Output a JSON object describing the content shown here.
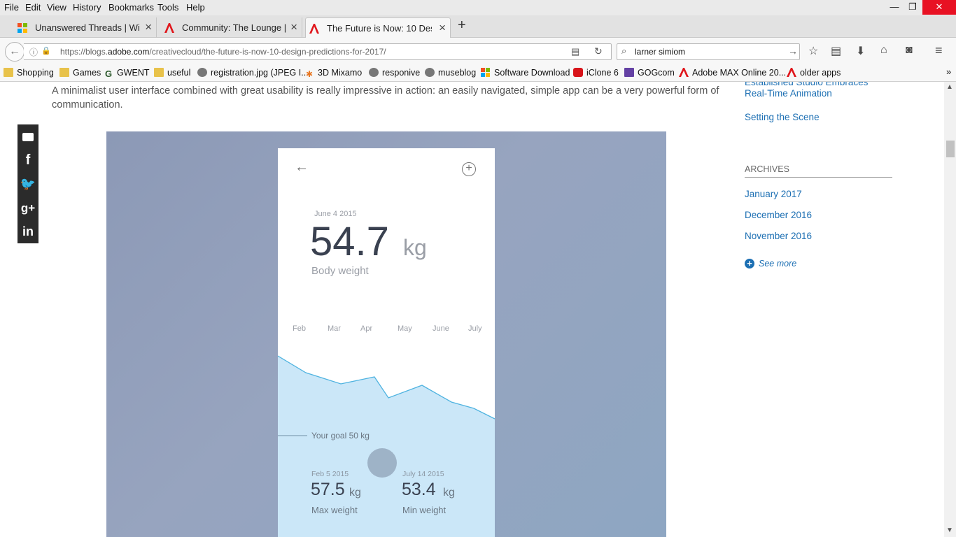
{
  "menubar": {
    "items": [
      "File",
      "Edit",
      "View",
      "History",
      "Bookmarks",
      "Tools",
      "Help"
    ],
    "window_controls": [
      "—",
      "❐",
      "✕"
    ]
  },
  "tabs": [
    {
      "title": "Unanswered Threads | Wi...",
      "active": false
    },
    {
      "title": "Community: The Lounge |...",
      "active": false
    },
    {
      "title": "The Future is Now: 10 Desi...",
      "active": true
    }
  ],
  "new_tab_label": "+",
  "navbar": {
    "url_prefix": "https://blogs.",
    "url_domain": "adobe.com",
    "url_path": "/creativecloud/the-future-is-now-10-design-predictions-for-2017/",
    "search_value": "larner simiom"
  },
  "bookmarks": [
    {
      "label": "Shopping",
      "icon": "folder-icon"
    },
    {
      "label": "Games",
      "icon": "folder-icon"
    },
    {
      "label": "GWENT",
      "icon": "gwent-icon"
    },
    {
      "label": "useful",
      "icon": "folder-icon"
    },
    {
      "label": "registration.jpg (JPEG I...",
      "icon": "globe-icon"
    },
    {
      "label": "3D Mixamo",
      "icon": "mixamo-icon"
    },
    {
      "label": "responive",
      "icon": "globe-icon"
    },
    {
      "label": "museblog",
      "icon": "globe-icon"
    },
    {
      "label": "Software Download",
      "icon": "windows-icon"
    },
    {
      "label": "iClone 6",
      "icon": "youtube-icon"
    },
    {
      "label": "GOGcom",
      "icon": "twitch-icon"
    },
    {
      "label": "Adobe MAX Online 20...",
      "icon": "adobe-icon"
    },
    {
      "label": "older apps",
      "icon": "adobe-icon"
    }
  ],
  "article": {
    "paragraph": "A minimalist user interface combined with great usability is really impressive in action: an easily navigated, simple app can be a very powerful form of communication."
  },
  "share_buttons": [
    "comment-icon",
    "facebook-icon",
    "twitter-icon",
    "googleplus-icon",
    "linkedin-icon"
  ],
  "sidebar": {
    "link_top_cut": "Established Studio Embraces",
    "link_top": "Real-Time Animation",
    "link_scene": "Setting the Scene",
    "archives_heading": "ARCHIVES",
    "archives": [
      "January 2017",
      "December 2016",
      "November 2016"
    ],
    "see_more": "See more"
  },
  "phone": {
    "date": "June 4 2015",
    "weight": "54.7",
    "unit": "kg",
    "caption": "Body weight",
    "months": [
      "Feb",
      "Mar",
      "Apr",
      "May",
      "June",
      "July"
    ],
    "goal": "Your goal 50 kg",
    "max": {
      "date": "Feb 5 2015",
      "value": "57.5",
      "unit": "kg",
      "label": "Max weight"
    },
    "min": {
      "date": "July 14 2015",
      "value": "53.4",
      "unit": "kg",
      "label": "Min weight"
    }
  },
  "colors": {
    "accent": "#1c6fb3",
    "chart_fill": "#cbe7f8",
    "chart_line": "#4fb3e0"
  }
}
